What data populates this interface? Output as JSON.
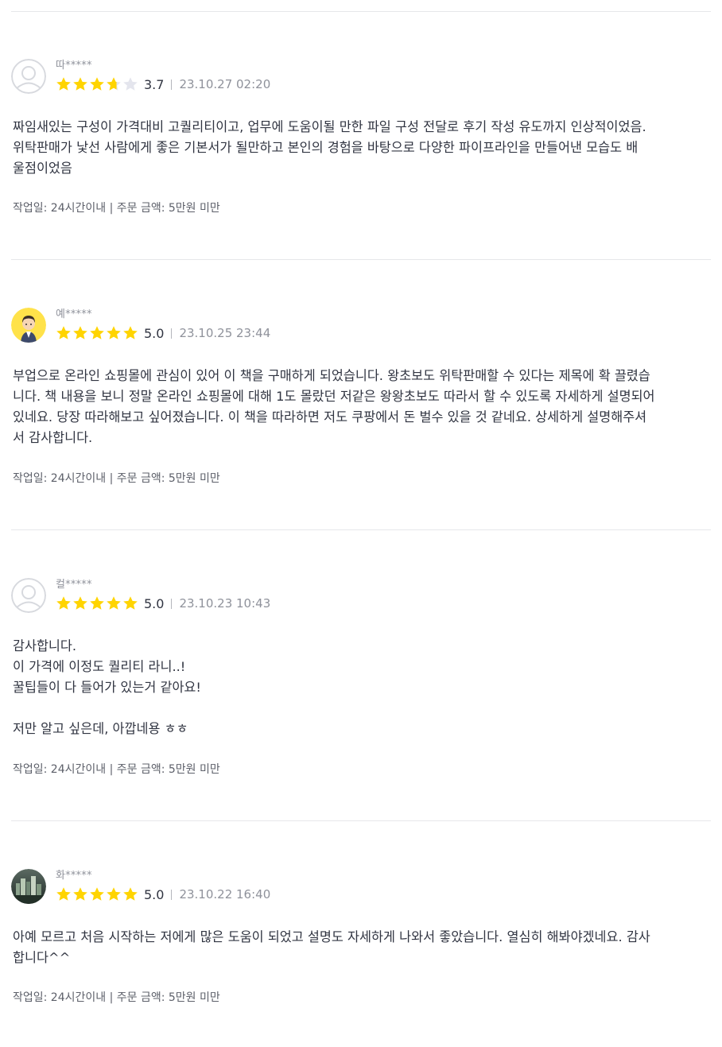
{
  "reviews": [
    {
      "username": "따*****",
      "avatar": "default-avatar-icon",
      "rating": 3.7,
      "score": "3.7",
      "date": "23.10.27 02:20",
      "content": "짜임새있는 구성이 가격대비 고퀄리티이고, 업무에 도움이될 만한 파일 구성 전달로 후기 작성 유도까지 인상적이었음.\n위탁판매가 낯선 사람에게 좋은 기본서가 될만하고 본인의 경험을 바탕으로 다양한 파이프라인을 만들어낸 모습도 배\n울점이었음",
      "meta": "작업일: 24시간이내 | 주문 금액: 5만원 미만"
    },
    {
      "username": "예*****",
      "avatar": "character-avatar",
      "rating": 5.0,
      "score": "5.0",
      "date": "23.10.25 23:44",
      "content": "부업으로 온라인 쇼핑몰에 관심이 있어 이 책을 구매하게 되었습니다. 왕초보도 위탁판매할 수 있다는 제목에 확 끌렸습\n니다. 책 내용을 보니 정말 온라인 쇼핑몰에 대해 1도 몰랐던 저같은 왕왕초보도 따라서 할 수 있도록 자세하게 설명되어\n있네요. 당장 따라해보고 싶어졌습니다. 이 책을 따라하면 저도 쿠팡에서 돈 벌수 있을 것 같네요. 상세하게 설명해주셔\n서 감사합니다.",
      "meta": "작업일: 24시간이내 | 주문 금액: 5만원 미만"
    },
    {
      "username": "컬*****",
      "avatar": "default-avatar-icon",
      "rating": 5.0,
      "score": "5.0",
      "date": "23.10.23 10:43",
      "content": "감사합니다.\n이 가격에 이정도 퀄리티 라니..!\n꿀팁들이 다 들어가 있는거 같아요!\n\n저만 알고 싶은데, 아깝네용 ㅎㅎ",
      "meta": "작업일: 24시간이내 | 주문 금액: 5만원 미만"
    },
    {
      "username": "화*****",
      "avatar": "photo-avatar",
      "rating": 5.0,
      "score": "5.0",
      "date": "23.10.22 16:40",
      "content": "아예 모르고 처음 시작하는 저에게 많은 도움이 되었고 설명도 자세하게 나와서 좋았습니다. 열심히 해봐야겠네요. 감사\n합니다^^",
      "meta": "작업일: 24시간이내 | 주문 금액: 5만원 미만"
    }
  ],
  "colors": {
    "star_filled": "#FFD400",
    "star_empty": "#E4E5ED",
    "divider": "#E6E7EA"
  }
}
